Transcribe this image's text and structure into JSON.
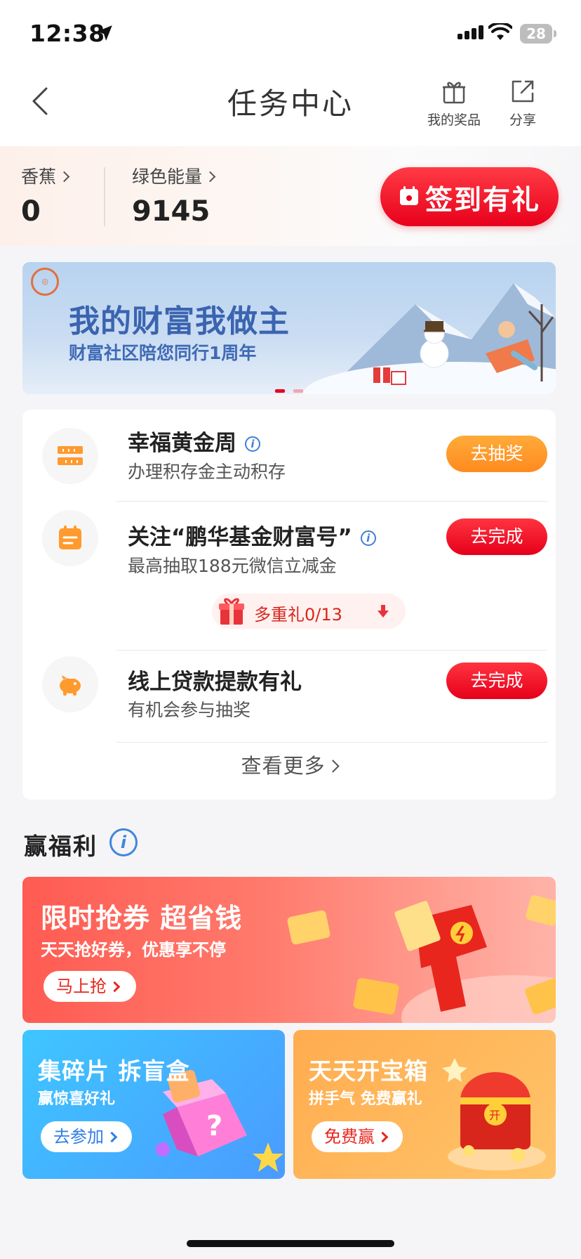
{
  "status_bar": {
    "time": "12:38",
    "battery": "28"
  },
  "nav": {
    "title": "任务中心",
    "my_prizes": "我的奖品",
    "share": "分享"
  },
  "assets": {
    "banana_label": "香蕉",
    "banana_value": "0",
    "energy_label": "绿色能量",
    "energy_value": "9145"
  },
  "signin_button": "签到有礼",
  "banner": {
    "headline": "我的财富我做主",
    "subline": "财富社区陪您同行1周年",
    "active_slide": 1,
    "slide_count": 2
  },
  "tasks": [
    {
      "title": "幸福黄金周",
      "desc": "办理积存金主动积存",
      "button": "去抽奖",
      "icon": "gold-bar-icon"
    },
    {
      "title": "关注“鹏华基金财富号”",
      "desc": "最高抽取188元微信立减金",
      "button": "去完成",
      "icon": "calendar-icon"
    },
    {
      "title": "线上贷款提款有礼",
      "desc": "有机会参与抽奖",
      "button": "去完成",
      "icon": "piggy-bank-icon"
    }
  ],
  "multi_gift": "多重礼0/13",
  "see_more": "查看更多",
  "welfare": {
    "title": "赢福利",
    "coupon": {
      "title": "限时抢券 超省钱",
      "sub": "天天抢好券，优惠享不停",
      "button": "马上抢"
    },
    "blindbox": {
      "title": "集碎片 拆盲盒",
      "sub": "赢惊喜好礼",
      "button": "去参加"
    },
    "treasure": {
      "title": "天天开宝箱",
      "sub": "拼手气 免费赢礼",
      "button": "免费赢"
    }
  },
  "colors": {
    "primary_red": "#e8001b",
    "orange": "#ff8a1f",
    "link_blue": "#3f7fd8"
  }
}
